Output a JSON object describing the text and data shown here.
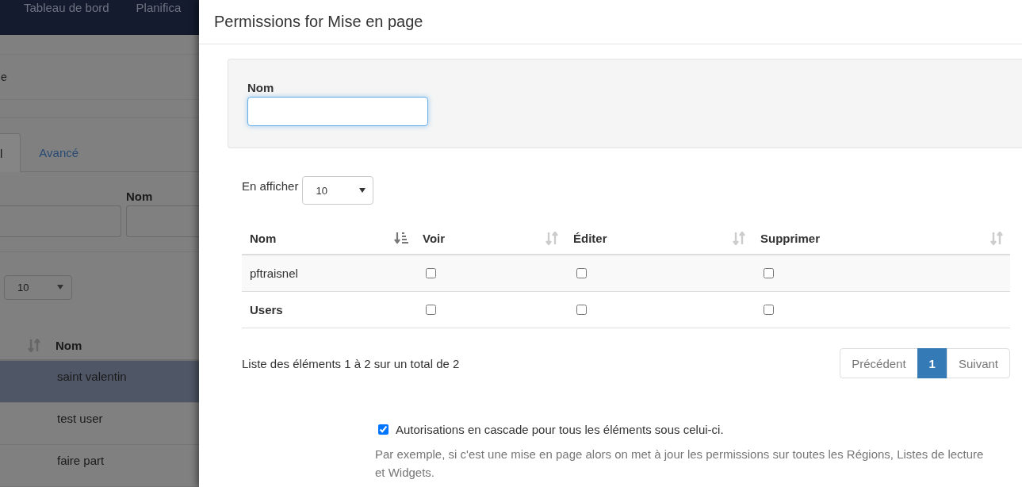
{
  "background_page": {
    "navbar": {
      "items": [
        "Tableau de bord",
        "Planifica"
      ]
    },
    "breadcrumb": "e",
    "tabs": [
      {
        "label": "l",
        "selected": true
      },
      {
        "label": "Avancé",
        "selected": false
      }
    ],
    "filter": {
      "label": "Nom"
    },
    "page_size": {
      "value": "10"
    },
    "table": {
      "columns": [
        "Nom"
      ],
      "rows": [
        {
          "name": "saint valentin",
          "selected": true
        },
        {
          "name": "test user",
          "selected": false
        },
        {
          "name": "faire part",
          "selected": false
        }
      ]
    }
  },
  "dialog": {
    "title": "Permissions for Mise en page",
    "filter": {
      "label": "Nom"
    },
    "page_size": {
      "label": "En afficher",
      "value": "10"
    },
    "table": {
      "columns": [
        {
          "label": "Nom",
          "sorted": true
        },
        {
          "label": "Voir",
          "sorted": false
        },
        {
          "label": "Éditer",
          "sorted": false
        },
        {
          "label": "Supprimer",
          "sorted": false
        }
      ],
      "rows": [
        {
          "name": "pftraisnel",
          "kind": "user",
          "voir": false,
          "editer": false,
          "supprimer": false
        },
        {
          "name": "Users",
          "kind": "group",
          "voir": false,
          "editer": false,
          "supprimer": false
        }
      ]
    },
    "info": "Liste des éléments 1 à 2 sur un total de 2",
    "pagination": [
      {
        "label": "Précédent",
        "selected": false
      },
      {
        "label": "1",
        "selected": true
      },
      {
        "label": "Suivant",
        "selected": false
      }
    ],
    "cascade": {
      "label": "Autorisations en cascade pour tous les éléments sous celui-ci.",
      "checked": true
    },
    "help": "Par exemple, si c'est une mise en page alors on met à jour les permissions sur toutes les Régions, Listes de lecture et Widgets."
  }
}
